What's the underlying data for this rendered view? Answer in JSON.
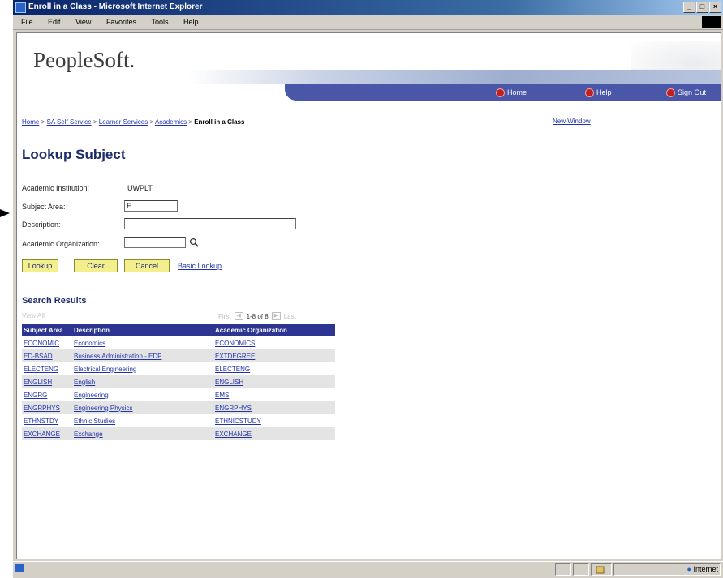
{
  "window": {
    "title": "Enroll in a Class - Microsoft Internet Explorer",
    "buttons": [
      "_",
      "□",
      "×"
    ]
  },
  "menu": [
    "File",
    "Edit",
    "View",
    "Favorites",
    "Tools",
    "Help"
  ],
  "header": {
    "logo": "PeopleSoft.",
    "nav": {
      "home": "Home",
      "help": "Help",
      "signout": "Sign Out"
    }
  },
  "breadcrumb": {
    "items": [
      "Home",
      "SA Self Service",
      "Learner Services",
      "Academics"
    ],
    "separator": ">",
    "current": "Enroll in a Class",
    "new_window": "New Window"
  },
  "page": {
    "title": "Lookup Subject",
    "institution_label": "Academic Institution:",
    "institution_value": "UWPLT",
    "subject_label": "Subject Area:",
    "subject_value": "E",
    "description_label": "Description:",
    "description_value": "",
    "org_label": "Academic Organization:",
    "org_value": ""
  },
  "buttons": {
    "lookup": "Lookup",
    "clear": "Clear",
    "cancel": "Cancel",
    "basic_lookup": "Basic Lookup"
  },
  "results": {
    "title": "Search Results",
    "view_all": "View All",
    "first": "First",
    "count": "1-8 of 8",
    "last": "Last",
    "headers": [
      "Subject Area",
      "Description",
      "Academic Organization"
    ],
    "rows": [
      [
        "ECONOMIC",
        "Economics",
        "ECONOMICS"
      ],
      [
        "ED-BSAD",
        "Business Administration - EDP",
        "EXTDEGREE"
      ],
      [
        "ELECTENG",
        "Electrical Engineering",
        "ELECTENG"
      ],
      [
        "ENGLISH",
        "English",
        "ENGLISH"
      ],
      [
        "ENGRG",
        "Engineering",
        "EMS"
      ],
      [
        "ENGRPHYS",
        "Engineering Physics",
        "ENGRPHYS"
      ],
      [
        "ETHNSTDY",
        "Ethnic Studies",
        "ETHNICSTUDY"
      ],
      [
        "EXCHANGE",
        "Exchange",
        "EXCHANGE"
      ]
    ]
  },
  "status": {
    "zone": "Internet"
  },
  "colors": {
    "nav_bar": "#4a56a8",
    "table_header": "#2d3592",
    "button_fill": "#f3ef8c"
  }
}
